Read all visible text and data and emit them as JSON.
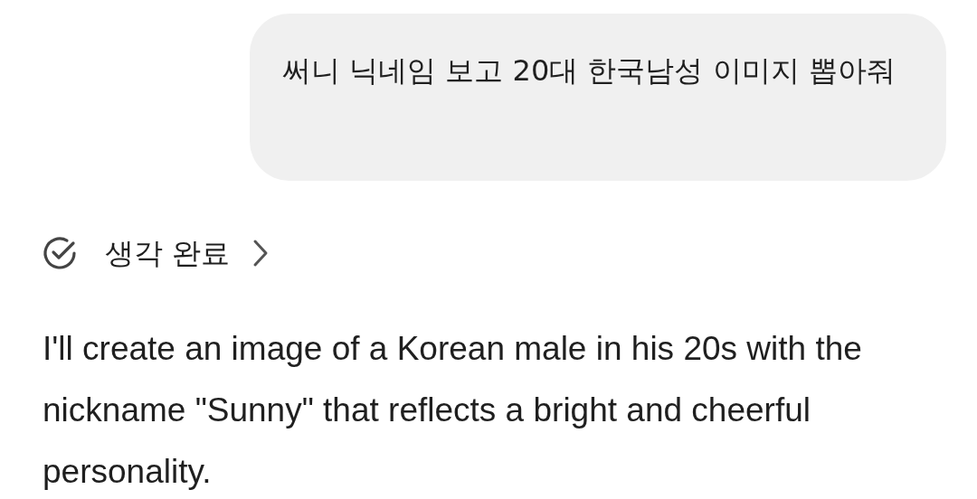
{
  "user_message": {
    "text": "써니 닉네임 보고 20대 한국남성 이미지 뽑아줘"
  },
  "thinking": {
    "label": "생각 완료",
    "expanded": false
  },
  "response": {
    "text": "I'll create an image of a Korean male in his 20s with the nickname \"Sunny\" that reflects a bright and cheerful personality."
  }
}
